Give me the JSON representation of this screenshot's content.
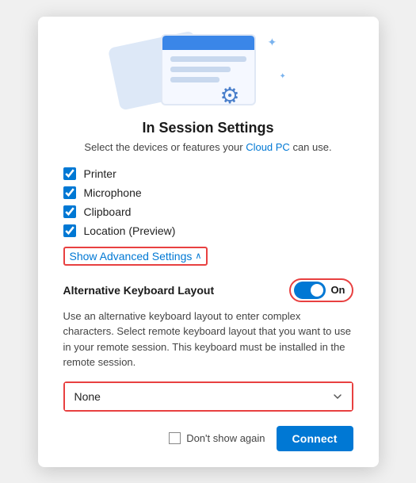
{
  "dialog": {
    "title": "In Session Settings",
    "subtitle_prefix": "Select the devices or features your ",
    "subtitle_link": "Cloud PC",
    "subtitle_suffix": " can use."
  },
  "checkboxes": [
    {
      "label": "Printer",
      "checked": true
    },
    {
      "label": "Microphone",
      "checked": true
    },
    {
      "label": "Clipboard",
      "checked": true
    },
    {
      "label": "Location (Preview)",
      "checked": true
    }
  ],
  "show_advanced": {
    "label": "Show Advanced Settings",
    "chevron": "∧"
  },
  "advanced": {
    "keyboard_layout_label": "Alternative Keyboard Layout",
    "toggle_state": "On",
    "description": "Use an alternative keyboard layout to enter complex characters. Select remote keyboard layout that you want to use in your remote session. This keyboard must be installed in the remote session.",
    "dropdown": {
      "value": "None",
      "options": [
        "None"
      ]
    }
  },
  "footer": {
    "dont_show_label": "Don't show again",
    "connect_label": "Connect"
  },
  "colors": {
    "accent": "#0078d4",
    "highlight_border": "#e84040"
  }
}
